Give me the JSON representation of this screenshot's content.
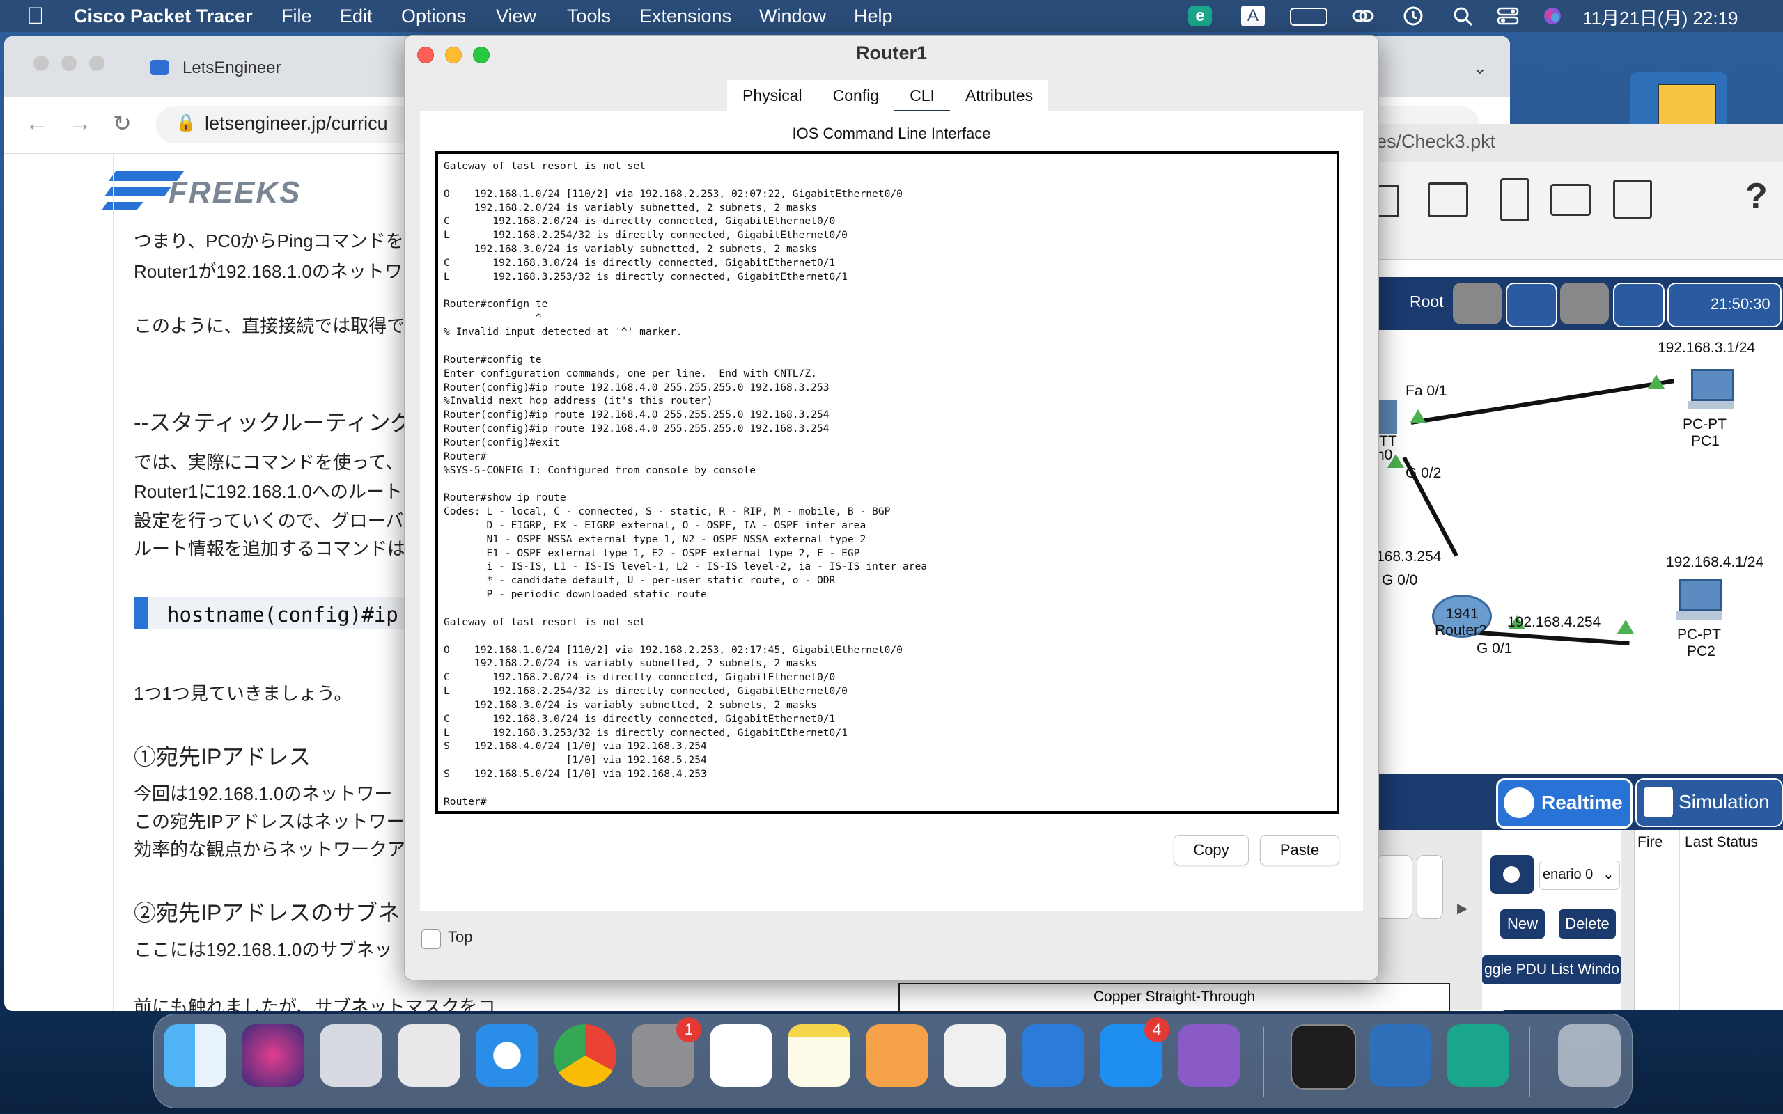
{
  "menubar": {
    "app_name": "Cisco Packet Tracer",
    "items": [
      "File",
      "Edit",
      "Options",
      "View",
      "Tools",
      "Extensions",
      "Window",
      "Help"
    ],
    "clock": "11月21日(月)  22:19"
  },
  "browser": {
    "tab_title": "LetsEngineer",
    "url": "letsengineer.jp/curricu",
    "logo_text": "FREEKS",
    "lines": [
      "つまり、PC0からPingコマンドを",
      "Router1が192.168.1.0のネットワ",
      "このように、直接接続では取得で",
      "--スタティックルーティング",
      "では、実際にコマンドを使って、",
      "Router1に192.168.1.0へのルート",
      "設定を行っていくので、グローバ",
      "ルート情報を追加するコマンドは",
      "1つ1つ見ていきましょう。",
      "①宛先IPアドレス",
      "今回は192.168.1.0のネットワー",
      "この宛先IPアドレスはネットワー",
      "効率的な観点からネットワークア",
      "②宛先IPアドレスのサブネ",
      "ここには192.168.1.0のサブネッ",
      "前にも触れましたが、サブネットマスクをコ"
    ],
    "code_box": "hostname(config)#ip"
  },
  "packet_tracer": {
    "file_title": "es/Check3.pkt",
    "root_label": "Root",
    "sim_time": "21:50:30",
    "labels": {
      "pc1_net": "192.168.3.1/24",
      "fa01": "Fa 0/1",
      "pc1_type": "PC-PT",
      "pc1_name": "PC1",
      "switch_frag": "TT",
      "switch_frag2": "h0",
      "g02": "G 0/2",
      "r_ip": "168.3.254",
      "g00": "G 0/0",
      "r_model": "1941",
      "r_name": "Router2",
      "g01": "G 0/1",
      "r_ip2": "192.168.4.254",
      "pc2_net": "192.168.4.1/24",
      "pc2_type": "PC-PT",
      "pc2_name": "PC2"
    },
    "realtime": "Realtime",
    "simulation": "Simulation",
    "scenario": "enario 0",
    "new_btn": "New",
    "delete_btn": "Delete",
    "toggle_btn": "ggle PDU List Windo",
    "col_fire": "Fire",
    "col_last_status": "Last Status",
    "cable_label": "Copper Straight-Through"
  },
  "dialog": {
    "title": "Router1",
    "tabs": [
      "Physical",
      "Config",
      "CLI",
      "Attributes"
    ],
    "active_tab": "CLI",
    "panel_title": "IOS Command Line Interface",
    "terminal_lines": [
      "Gateway of last resort is not set",
      "",
      "O    192.168.1.0/24 [110/2] via 192.168.2.253, 02:07:22, GigabitEthernet0/0",
      "     192.168.2.0/24 is variably subnetted, 2 subnets, 2 masks",
      "C       192.168.2.0/24 is directly connected, GigabitEthernet0/0",
      "L       192.168.2.254/32 is directly connected, GigabitEthernet0/0",
      "     192.168.3.0/24 is variably subnetted, 2 subnets, 2 masks",
      "C       192.168.3.0/24 is directly connected, GigabitEthernet0/1",
      "L       192.168.3.253/32 is directly connected, GigabitEthernet0/1",
      "",
      "Router#confign te",
      "               ^",
      "% Invalid input detected at '^' marker.",
      "",
      "Router#config te",
      "Enter configuration commands, one per line.  End with CNTL/Z.",
      "Router(config)#ip route 192.168.4.0 255.255.255.0 192.168.3.253",
      "%Invalid next hop address (it's this router)",
      "Router(config)#ip route 192.168.4.0 255.255.255.0 192.168.3.254",
      "Router(config)#ip route 192.168.4.0 255.255.255.0 192.168.3.254",
      "Router(config)#exit",
      "Router#",
      "%SYS-5-CONFIG_I: Configured from console by console",
      "",
      "Router#show ip route",
      "Codes: L - local, C - connected, S - static, R - RIP, M - mobile, B - BGP",
      "       D - EIGRP, EX - EIGRP external, O - OSPF, IA - OSPF inter area",
      "       N1 - OSPF NSSA external type 1, N2 - OSPF NSSA external type 2",
      "       E1 - OSPF external type 1, E2 - OSPF external type 2, E - EGP",
      "       i - IS-IS, L1 - IS-IS level-1, L2 - IS-IS level-2, ia - IS-IS inter area",
      "       * - candidate default, U - per-user static route, o - ODR",
      "       P - periodic downloaded static route",
      "",
      "Gateway of last resort is not set",
      "",
      "O    192.168.1.0/24 [110/2] via 192.168.2.253, 02:17:45, GigabitEthernet0/0",
      "     192.168.2.0/24 is variably subnetted, 2 subnets, 2 masks",
      "C       192.168.2.0/24 is directly connected, GigabitEthernet0/0",
      "L       192.168.2.254/32 is directly connected, GigabitEthernet0/0",
      "     192.168.3.0/24 is variably subnetted, 2 subnets, 2 masks",
      "C       192.168.3.0/24 is directly connected, GigabitEthernet0/1",
      "L       192.168.3.253/32 is directly connected, GigabitEthernet0/1",
      "S    192.168.4.0/24 [1/0] via 192.168.3.254",
      "                    [1/0] via 192.168.5.254",
      "S    192.168.5.0/24 [1/0] via 192.168.4.253",
      "",
      "Router#"
    ],
    "copy_btn": "Copy",
    "paste_btn": "Paste",
    "top_label": "Top"
  },
  "dock": {
    "settings_badge": "1",
    "appstore_badge": "4"
  }
}
